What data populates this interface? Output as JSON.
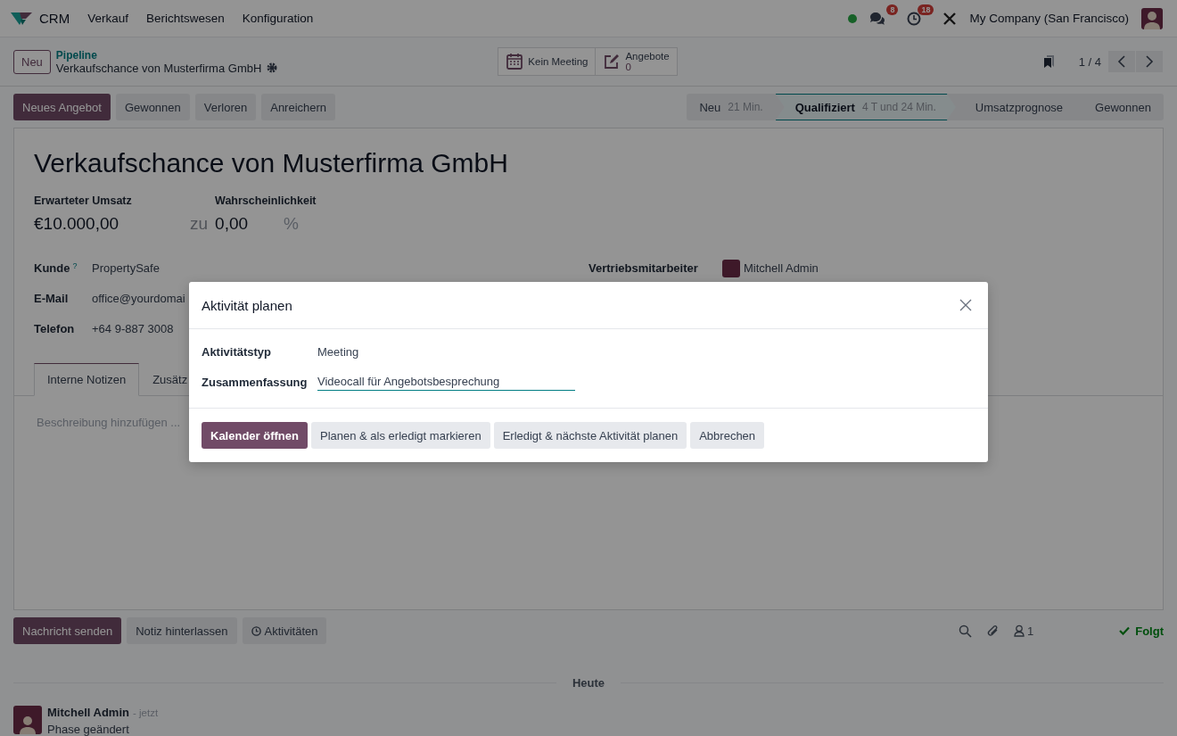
{
  "navbar": {
    "app": "CRM",
    "menus": [
      "Verkauf",
      "Berichtswesen",
      "Konfiguration"
    ],
    "messages_badge": "8",
    "activities_badge": "18",
    "company": "My Company (San Francisco)"
  },
  "control_panel": {
    "new_button": "Neu",
    "breadcrumb": "Pipeline",
    "record_title": "Verkaufschance von Musterfirma GmbH",
    "smart_buttons": [
      {
        "kind": "calendar",
        "label": "Kein Meeting"
      },
      {
        "kind": "edit",
        "label": "Angebote",
        "count": "0"
      }
    ],
    "pager": "1 / 4"
  },
  "actions": [
    {
      "label": "Neues Angebot",
      "primary": true
    },
    {
      "label": "Gewonnen",
      "primary": false
    },
    {
      "label": "Verloren",
      "primary": false
    },
    {
      "label": "Anreichern",
      "primary": false
    }
  ],
  "stages": [
    {
      "name": "Neu",
      "duration": "21 Min.",
      "selected": false
    },
    {
      "name": "Qualifiziert",
      "duration": "4 T und 24 Min.",
      "selected": true
    },
    {
      "name": "Umsatzprognose",
      "selected": false
    },
    {
      "name": "Gewonnen",
      "selected": false
    }
  ],
  "form": {
    "title": "Verkaufschance von Musterfirma GmbH",
    "expected_revenue": {
      "label": "Erwarteter Umsatz",
      "value": "€10.000,00"
    },
    "probability": {
      "label": "Wahrscheinlichkeit",
      "prefix": "zu",
      "value": "0,00",
      "unit": "%"
    },
    "fields": [
      {
        "label": "Kunde",
        "help": "?",
        "value": "PropertySafe"
      },
      {
        "label": "E-Mail",
        "value": "office@yourdomai"
      },
      {
        "label": "Telefon",
        "value": "+64 9-887 3008"
      }
    ],
    "salesperson": {
      "label": "Vertriebsmitarbeiter",
      "value": "Mitchell Admin"
    },
    "tabs": [
      {
        "label": "Interne Notizen",
        "selected": true
      },
      {
        "label": "Zusätz",
        "selected": false
      }
    ],
    "notes_placeholder": "Beschreibung hinzufügen ..."
  },
  "chatter": {
    "buttons": [
      {
        "kind": "primary",
        "label": "Nachricht senden"
      },
      {
        "kind": "secondary",
        "label": "Notiz hinterlassen"
      },
      {
        "kind": "activity",
        "label": "Aktivitäten"
      }
    ],
    "followers": "1",
    "follow": "Folgt",
    "date": "Heute",
    "message": {
      "author": "Mitchell Admin",
      "time": "- jetzt",
      "body": "Phase geändert"
    }
  },
  "dialog": {
    "title": "Aktivität planen",
    "fields": [
      {
        "kind": "text",
        "label": "Aktivitätstyp",
        "value": "Meeting"
      },
      {
        "kind": "input",
        "label": "Zusammenfassung",
        "value": "Videocall für Angebotsbesprechung"
      }
    ],
    "buttons": [
      {
        "label": "Kalender öffnen",
        "primary": true
      },
      {
        "label": "Planen & als erledigt markieren",
        "primary": false
      },
      {
        "label": "Erledigt & nächste Aktivität planen",
        "primary": false
      },
      {
        "label": "Abbrechen",
        "primary": false
      }
    ]
  }
}
